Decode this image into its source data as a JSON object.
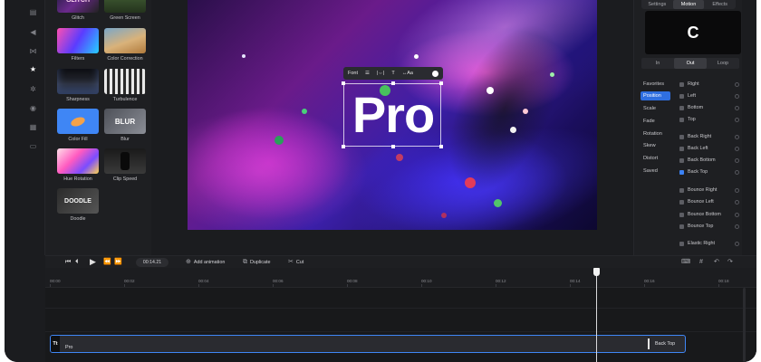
{
  "effects": {
    "items": [
      {
        "label": "Glitch",
        "thumb_text": "GLITCH"
      },
      {
        "label": "Green Screen",
        "thumb_text": ""
      },
      {
        "label": "Filters",
        "thumb_text": ""
      },
      {
        "label": "Color Correction",
        "thumb_text": ""
      },
      {
        "label": "Sharpness",
        "thumb_text": ""
      },
      {
        "label": "Turbulence",
        "thumb_text": ""
      },
      {
        "label": "Color Fill",
        "thumb_text": ""
      },
      {
        "label": "Blur",
        "thumb_text": "BLUR"
      },
      {
        "label": "Hue Rotation",
        "thumb_text": ""
      },
      {
        "label": "Clip Speed",
        "thumb_text": ""
      },
      {
        "label": "Doodle",
        "thumb_text": "DOODLE"
      }
    ]
  },
  "canvas": {
    "text": "Pro",
    "toolbar": {
      "font": "Font",
      "align": "☰",
      "spacing": "|⇔|",
      "case": "T",
      "size": "↔Aa"
    }
  },
  "props": {
    "tabs": [
      "Settings",
      "Motion",
      "Effects"
    ],
    "active_tab": "Motion",
    "preview_glyph": "C",
    "phase": [
      "In",
      "Out",
      "Loop"
    ],
    "active_phase": "Out",
    "categories": [
      "Favorites",
      "Position",
      "Scale",
      "Fade",
      "Rotation",
      "Skew",
      "Distort",
      "Saved"
    ],
    "active_category": "Position",
    "animations": [
      {
        "label": "Right",
        "checked": false
      },
      {
        "label": "Left",
        "checked": false
      },
      {
        "label": "Bottom",
        "checked": false
      },
      {
        "label": "Top",
        "checked": false
      },
      {
        "label": "Back Right",
        "checked": false
      },
      {
        "label": "Back Left",
        "checked": false
      },
      {
        "label": "Back Bottom",
        "checked": false
      },
      {
        "label": "Back Top",
        "checked": true
      },
      {
        "label": "Bounce Right",
        "checked": false
      },
      {
        "label": "Bounce Left",
        "checked": false
      },
      {
        "label": "Bounce Bottom",
        "checked": false
      },
      {
        "label": "Bounce Top",
        "checked": false
      },
      {
        "label": "Elastic Right",
        "checked": false
      }
    ]
  },
  "toolbar": {
    "timecode": "00:14.21",
    "add_animation": "Add animation",
    "duplicate": "Duplicate",
    "cut": "Cut"
  },
  "timeline": {
    "ticks": [
      "00:00",
      "00:02",
      "00:04",
      "00:06",
      "00:08",
      "00:10",
      "00:12",
      "00:14",
      "00:16",
      "00:18"
    ],
    "clip": {
      "tag": "Tt",
      "name": "Pro",
      "animation": "Back Top"
    }
  }
}
